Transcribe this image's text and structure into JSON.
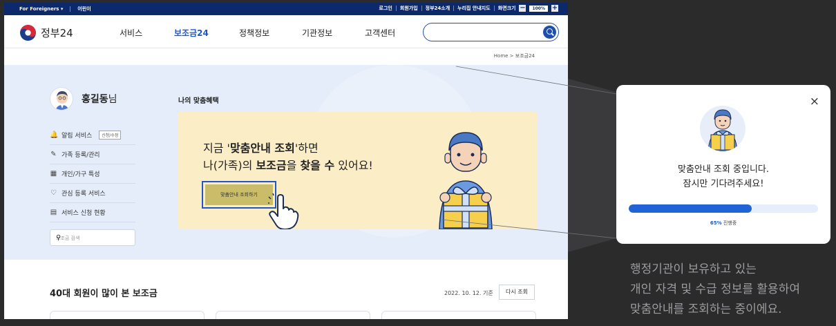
{
  "utility_bar": {
    "foreigners": "For Foreigners ▾",
    "kids": "어린이",
    "links": [
      "로그인",
      "회원가입",
      "정부24소개",
      "누리집 안내지도",
      "화면크기"
    ],
    "font_size_value": "100%",
    "minus": "−",
    "plus": "+"
  },
  "header": {
    "logo_text": "정부24",
    "menu": [
      "서비스",
      "보조금24",
      "정책정보",
      "기관정보",
      "고객센터"
    ],
    "active_menu": "보조금24"
  },
  "breadcrumb": "Home > 보조금24",
  "user": {
    "name": "홍길동",
    "suffix": "님"
  },
  "side_menu": [
    {
      "label": "알림 서비스",
      "icon": "bell-icon",
      "glyph": "🔔",
      "tag": "신청/수정"
    },
    {
      "label": "가족 등록/관리",
      "icon": "edit-icon",
      "glyph": "✎"
    },
    {
      "label": "개인/가구 특성",
      "icon": "calendar-icon",
      "glyph": "▦"
    },
    {
      "label": "관심 등록 서비스",
      "icon": "heart-icon",
      "glyph": "♡"
    },
    {
      "label": "서비스 신청 현황",
      "icon": "document-icon",
      "glyph": "▤"
    }
  ],
  "side_search": {
    "placeholder": "보조금 검색",
    "icon": "search-icon"
  },
  "benefit": {
    "title": "나의 맞춤혜택",
    "line1_pre": "지금 '",
    "line1_bold": "맞춤안내 조회",
    "line1_post": "'하면",
    "line2_pre": "나(가족)의 ",
    "line2_bold1": "보조금",
    "line2_mid": "을 ",
    "line2_bold2": "찾을 수",
    "line2_post": " 있어요!",
    "cta": "맞춤안내 조회하기"
  },
  "popular": {
    "title": "40대 회원이 많이 본 보조금",
    "date": "2022. 10. 12. 기준",
    "reload": "다시 조회"
  },
  "popup": {
    "close": "×",
    "message_line1": "맞춤안내 조회 중입니다.",
    "message_line2": "잠시만 기다려주세요!",
    "progress_percent": 65,
    "progress_value_label": "65%",
    "progress_suffix": "진행중"
  },
  "caption": {
    "line1": "행정기관이 보유하고 있는",
    "line2": "개인 자격 및 수급 정보를 활용하여",
    "line3": "맞춤안내를 조회하는 중이에요."
  },
  "colors": {
    "utility_bar": "#0c2a6b",
    "accent": "#1f57c3",
    "hero_bg": "#e4edf9",
    "banner_bg": "#fbeec7",
    "progress": "#1f63d6",
    "outer_bg": "#2b2b2c"
  }
}
